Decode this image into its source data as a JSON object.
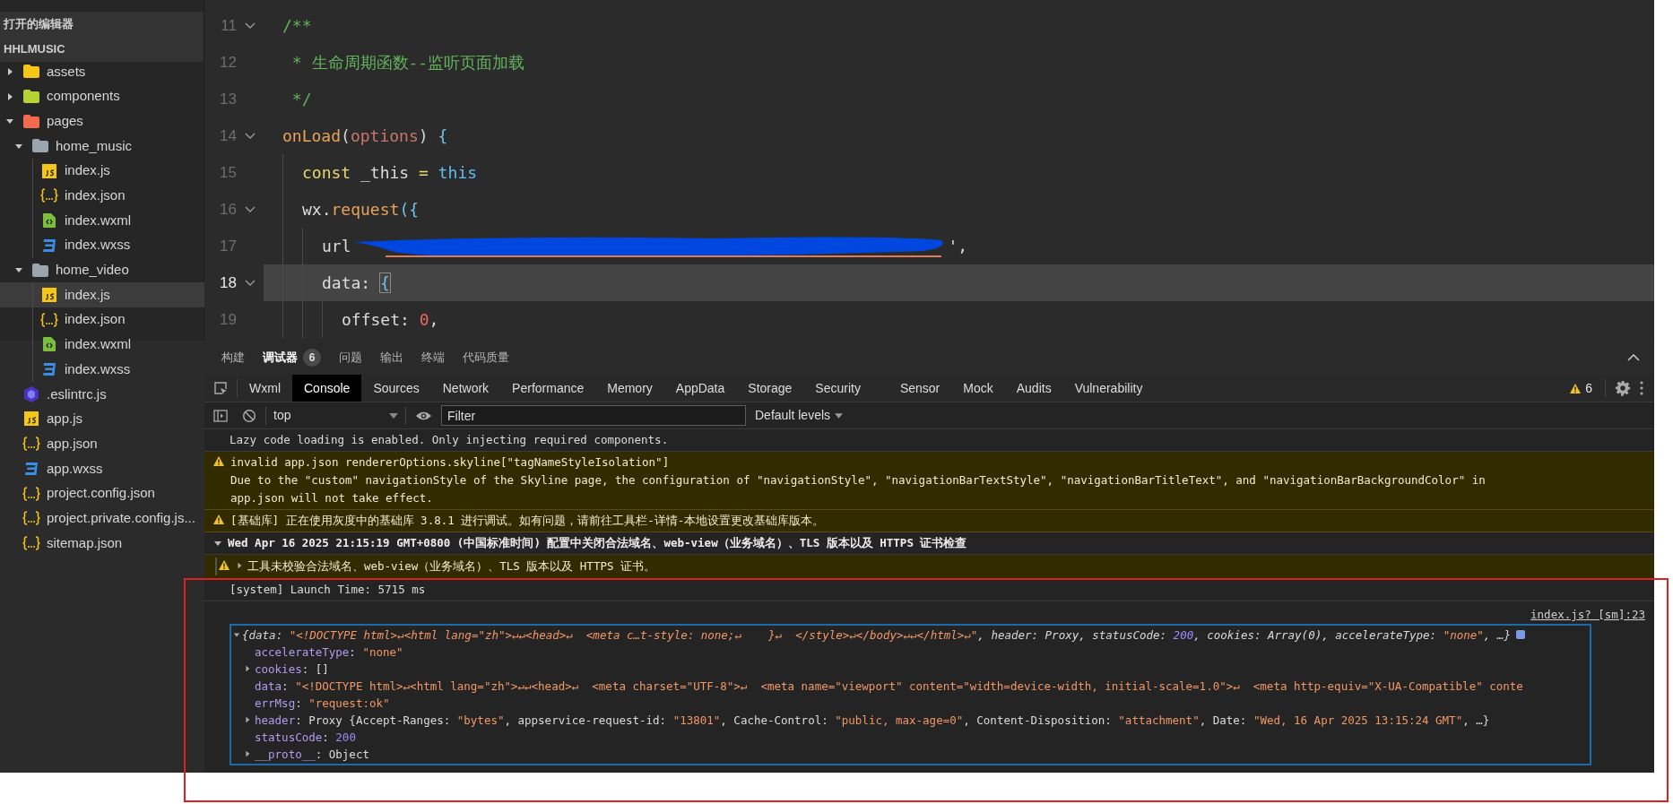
{
  "sidebar": {
    "header": "打开的编辑器",
    "project": "HHLMUSIC",
    "items": [
      {
        "name": "assets",
        "kind": "folder",
        "color": "#f5c518",
        "expanded": false,
        "selected": false
      },
      {
        "name": "components",
        "kind": "folder",
        "color": "#b5d334",
        "expanded": false,
        "selected": false
      },
      {
        "name": "pages",
        "kind": "folder",
        "color": "#f26b4f",
        "expanded": true,
        "selected": false,
        "children": [
          {
            "name": "home_music",
            "kind": "folder",
            "color": "#9aa5ad",
            "expanded": true,
            "selected": false,
            "children": [
              {
                "name": "index.js",
                "kind": "js",
                "selected": false
              },
              {
                "name": "index.json",
                "kind": "json",
                "selected": false
              },
              {
                "name": "index.wxml",
                "kind": "wxml",
                "selected": false
              },
              {
                "name": "index.wxss",
                "kind": "wxss",
                "selected": false
              }
            ]
          },
          {
            "name": "home_video",
            "kind": "folder",
            "color": "#9aa5ad",
            "expanded": true,
            "selected": false,
            "children": [
              {
                "name": "index.js",
                "kind": "js",
                "selected": true
              },
              {
                "name": "index.json",
                "kind": "json",
                "selected": false
              },
              {
                "name": "index.wxml",
                "kind": "wxml",
                "selected": false
              },
              {
                "name": "index.wxss",
                "kind": "wxss",
                "selected": false
              }
            ]
          }
        ]
      },
      {
        "name": ".eslintrc.js",
        "kind": "eslint",
        "selected": false
      },
      {
        "name": "app.js",
        "kind": "js",
        "selected": false
      },
      {
        "name": "app.json",
        "kind": "json",
        "selected": false
      },
      {
        "name": "app.wxss",
        "kind": "wxss",
        "selected": false
      },
      {
        "name": "project.config.json",
        "kind": "json",
        "selected": false
      },
      {
        "name": "project.private.config.js...",
        "kind": "json",
        "selected": false
      },
      {
        "name": "sitemap.json",
        "kind": "json",
        "selected": false
      }
    ]
  },
  "editor": {
    "lines": [
      {
        "num": "11",
        "foldable": true,
        "current": false,
        "tokens": [
          {
            "t": "/**",
            "kind": "comment"
          }
        ]
      },
      {
        "num": "12",
        "foldable": false,
        "current": false,
        "tokens": [
          {
            "t": " * 生命周期函数--监听页面加载",
            "kind": "comment"
          }
        ]
      },
      {
        "num": "13",
        "foldable": false,
        "current": false,
        "tokens": [
          {
            "t": " */",
            "kind": "comment"
          }
        ]
      },
      {
        "num": "14",
        "foldable": true,
        "current": false,
        "tokens": [
          {
            "t": "onLoad",
            "kind": "func"
          },
          {
            "t": "(",
            "kind": "paren"
          },
          {
            "t": "options",
            "kind": "param"
          },
          {
            "t": ")",
            "kind": "paren"
          },
          {
            "t": " {",
            "kind": "punct"
          }
        ],
        "children": [
          {
            "num": "15",
            "foldable": false,
            "current": false,
            "tokens": [
              {
                "t": "const",
                "kind": "keyword"
              },
              {
                "t": " _this ",
                "kind": "plain"
              },
              {
                "t": "=",
                "kind": "keyword"
              },
              {
                "t": " this",
                "kind": "this"
              }
            ]
          },
          {
            "num": "16",
            "foldable": true,
            "current": false,
            "tokens": [
              {
                "t": "wx.",
                "kind": "plain"
              },
              {
                "t": "request",
                "kind": "func"
              },
              {
                "t": "({",
                "kind": "punct"
              }
            ],
            "children": [
              {
                "num": "17",
                "foldable": false,
                "current": false,
                "tokens": [
                  {
                    "t": "url",
                    "kind": "plain"
                  },
                  {
                    "kind": "redaction"
                  },
                  {
                    "t": "',",
                    "kind": "plain"
                  }
                ]
              },
              {
                "num": "18",
                "foldable": true,
                "current": true,
                "tokens": [
                  {
                    "t": "data: ",
                    "kind": "plain"
                  },
                  {
                    "t": "{",
                    "kind": "punct"
                  }
                ],
                "children": [
                  {
                    "num": "19",
                    "foldable": false,
                    "current": false,
                    "tokens": [
                      {
                        "t": "offset: ",
                        "kind": "plain"
                      },
                      {
                        "t": "0",
                        "kind": "number"
                      },
                      {
                        "t": ",",
                        "kind": "plain"
                      }
                    ]
                  }
                ]
              }
            ]
          }
        ]
      }
    ]
  },
  "devtools": {
    "tabs": [
      {
        "label": "构建",
        "selected": false
      },
      {
        "label": "调试器",
        "selected": true,
        "badge": "6"
      },
      {
        "label": "问题",
        "selected": false
      },
      {
        "label": "输出",
        "selected": false
      },
      {
        "label": "终端",
        "selected": false
      },
      {
        "label": "代码质量",
        "selected": false
      }
    ],
    "panels": [
      {
        "label": "Wxml",
        "selected": false
      },
      {
        "label": "Console",
        "selected": true
      },
      {
        "label": "Sources",
        "selected": false
      },
      {
        "label": "Network",
        "selected": false
      },
      {
        "label": "Performance",
        "selected": false
      },
      {
        "label": "Memory",
        "selected": false
      },
      {
        "label": "AppData",
        "selected": false
      },
      {
        "label": "Storage",
        "selected": false
      },
      {
        "label": "Security",
        "selected": false
      },
      {
        "label": "Sensor",
        "selected": false
      },
      {
        "label": "Mock",
        "selected": false
      },
      {
        "label": "Audits",
        "selected": false
      },
      {
        "label": "Vulnerability",
        "selected": false
      }
    ],
    "warning_count": "6",
    "context": "top",
    "filter": {
      "placeholder": "Filter"
    },
    "levels": "Default levels",
    "messages": [
      {
        "kind": "log",
        "lines": [
          "Lazy code loading is enabled. Only injecting required components."
        ]
      },
      {
        "kind": "warning",
        "lines": [
          "invalid app.json rendererOptions.skyline[\"tagNameStyleIsolation\"]",
          "Due to the \"custom\" navigationStyle of the Skyline page, the configuration of \"navigationStyle\", \"navigationBarTextStyle\", \"navigationBarTitleText\", and \"navigationBarBackgroundColor\" in",
          "app.json will not take effect."
        ]
      },
      {
        "kind": "warning",
        "lines": [
          "[基础库] 正在使用灰度中的基础库 3.8.1 进行调试。如有问题，请前往工具栏-详情-本地设置更改基础库版本。"
        ]
      },
      {
        "kind": "group",
        "expanded": true,
        "lines": [
          "Wed Apr 16 2025 21:15:19 GMT+0800 (中国标准时间) 配置中关闭合法域名、web-view（业务域名）、TLS 版本以及 HTTPS 证书检查"
        ]
      },
      {
        "kind": "nested_warning",
        "expanded": false,
        "lines": [
          "工具未校验合法域名、web-view（业务域名）、TLS 版本以及 HTTPS 证书。"
        ]
      },
      {
        "kind": "log",
        "lines": [
          "[system] Launch Time: 5715 ms"
        ]
      }
    ],
    "object": {
      "source": "index.js? [sm]:23",
      "expanded": true,
      "selected": true,
      "summary": [
        {
          "t": "{",
          "kind": "punct"
        },
        {
          "t": "data",
          "kind": "key"
        },
        {
          "t": ": ",
          "kind": "punct"
        },
        {
          "t": "\"<!DOCTYPE html>↵<html lang=\"zh\">↵↵<head>↵  <meta c…t-style: none;↵    }↵  </style>↵</body>↵↵</html>↵\"",
          "kind": "string"
        },
        {
          "t": ", ",
          "kind": "punct"
        },
        {
          "t": "header",
          "kind": "key"
        },
        {
          "t": ": Proxy, ",
          "kind": "punct"
        },
        {
          "t": "statusCode",
          "kind": "key"
        },
        {
          "t": ": ",
          "kind": "punct"
        },
        {
          "t": "200",
          "kind": "number"
        },
        {
          "t": ", ",
          "kind": "punct"
        },
        {
          "t": "cookies",
          "kind": "key"
        },
        {
          "t": ": Array(0), ",
          "kind": "punct"
        },
        {
          "t": "accelerateType",
          "kind": "key"
        },
        {
          "t": ": ",
          "kind": "punct"
        },
        {
          "t": "\"none\"",
          "kind": "string"
        },
        {
          "t": ", …}",
          "kind": "punct"
        }
      ],
      "properties": [
        {
          "kind": "leaf",
          "tokens": [
            {
              "t": "accelerateType",
              "kind": "key"
            },
            {
              "t": ": ",
              "kind": "punct"
            },
            {
              "t": "\"none\"",
              "kind": "string"
            }
          ]
        },
        {
          "kind": "expandable",
          "expanded": false,
          "tokens": [
            {
              "t": "cookies",
              "kind": "key"
            },
            {
              "t": ": []",
              "kind": "punct"
            }
          ]
        },
        {
          "kind": "leaf",
          "tokens": [
            {
              "t": "data",
              "kind": "key"
            },
            {
              "t": ": ",
              "kind": "punct"
            },
            {
              "t": "\"<!DOCTYPE html>↵<html lang=\"zh\">↵↵<head>↵  <meta charset=\"UTF-8\">↵  <meta name=\"viewport\" content=\"width=device-width, initial-scale=1.0\">↵  <meta http-equiv=\"X-UA-Compatible\" conte",
              "kind": "string"
            }
          ]
        },
        {
          "kind": "leaf",
          "tokens": [
            {
              "t": "errMsg",
              "kind": "key"
            },
            {
              "t": ": ",
              "kind": "punct"
            },
            {
              "t": "\"request:ok\"",
              "kind": "string"
            }
          ]
        },
        {
          "kind": "expandable",
          "expanded": false,
          "tokens": [
            {
              "t": "header",
              "kind": "key"
            },
            {
              "t": ": Proxy {Accept-Ranges: ",
              "kind": "punct"
            },
            {
              "t": "\"bytes\"",
              "kind": "string"
            },
            {
              "t": ", appservice-request-id: ",
              "kind": "punct"
            },
            {
              "t": "\"13801\"",
              "kind": "string"
            },
            {
              "t": ", Cache-Control: ",
              "kind": "punct"
            },
            {
              "t": "\"public, max-age=0\"",
              "kind": "string"
            },
            {
              "t": ", Content-Disposition: ",
              "kind": "punct"
            },
            {
              "t": "\"attachment\"",
              "kind": "string"
            },
            {
              "t": ", Date: ",
              "kind": "punct"
            },
            {
              "t": "\"Wed, 16 Apr 2025 13:15:24 GMT\"",
              "kind": "string"
            },
            {
              "t": ", …}",
              "kind": "punct"
            }
          ]
        },
        {
          "kind": "leaf",
          "tokens": [
            {
              "t": "statusCode",
              "kind": "key"
            },
            {
              "t": ": ",
              "kind": "punct"
            },
            {
              "t": "200",
              "kind": "number"
            }
          ]
        },
        {
          "kind": "expandable",
          "expanded": false,
          "tokens": [
            {
              "t": "__proto__",
              "kind": "key"
            },
            {
              "t": ": Object",
              "kind": "punct"
            }
          ]
        }
      ]
    }
  }
}
